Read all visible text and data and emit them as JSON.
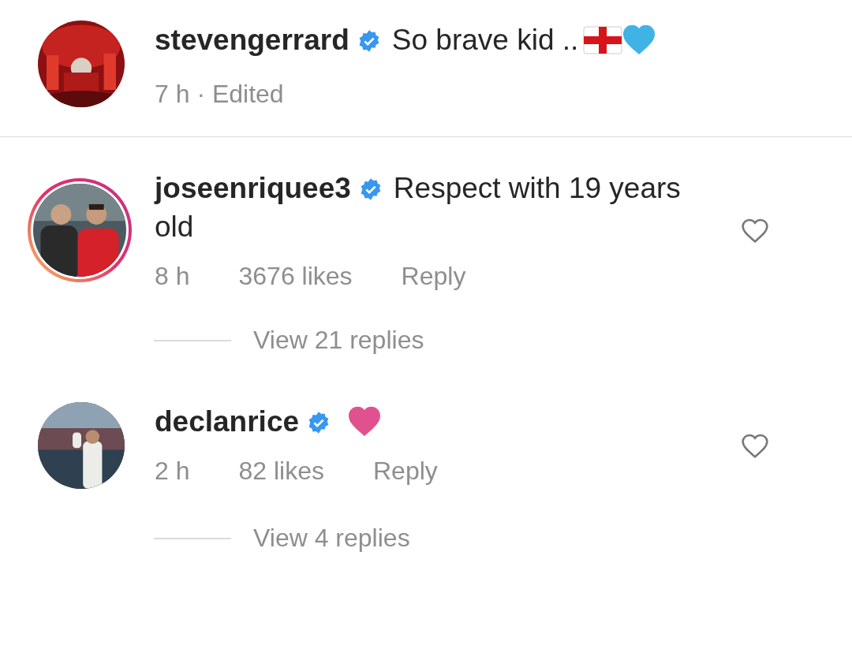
{
  "caption": {
    "username": "stevengerrard",
    "verified": true,
    "text": "So brave kid ..",
    "emojis": [
      {
        "kind": "flag"
      },
      {
        "kind": "heart",
        "color": "#3fb3e6"
      }
    ],
    "meta": "7 h · Edited"
  },
  "comments": [
    {
      "username": "joseenriquee3",
      "verified": true,
      "text": "Respect with 19 years old",
      "time": "8 h",
      "likes": "3676 likes",
      "reply": "Reply",
      "story_ring": true,
      "liked": false,
      "view_replies": "View 21 replies"
    },
    {
      "username": "declanrice",
      "verified": true,
      "emojis": [
        {
          "kind": "heart",
          "color": "#e0528f"
        }
      ],
      "time": "2 h",
      "likes": "82 likes",
      "reply": "Reply",
      "story_ring": false,
      "liked": false,
      "view_replies": "View 4 replies"
    }
  ]
}
